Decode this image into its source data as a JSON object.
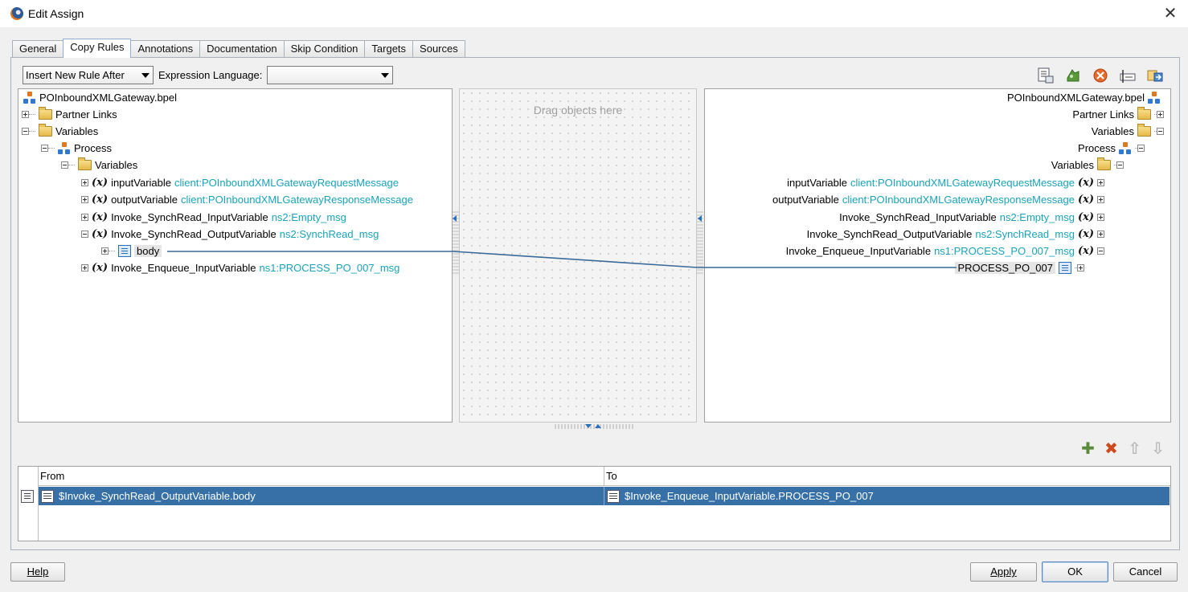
{
  "window": {
    "title": "Edit Assign"
  },
  "tabs": [
    {
      "label": "General"
    },
    {
      "label": "Copy Rules",
      "active": true
    },
    {
      "label": "Annotations"
    },
    {
      "label": "Documentation"
    },
    {
      "label": "Skip Condition"
    },
    {
      "label": "Targets"
    },
    {
      "label": "Sources"
    }
  ],
  "toolbar": {
    "insert_mode": "Insert New Rule After",
    "expression_language_label": "Expression Language:",
    "expression_language_value": ""
  },
  "source_tree": {
    "root": "POInboundXMLGateway.bpel",
    "partner_links": "Partner Links",
    "variables": "Variables",
    "process": "Process",
    "process_variables": "Variables",
    "items": [
      {
        "name": "inputVariable",
        "type": "client:POInboundXMLGatewayRequestMessage"
      },
      {
        "name": "outputVariable",
        "type": "client:POInboundXMLGatewayResponseMessage"
      },
      {
        "name": "Invoke_SynchRead_InputVariable",
        "type": "ns2:Empty_msg"
      },
      {
        "name": "Invoke_SynchRead_OutputVariable",
        "type": "ns2:SynchRead_msg"
      },
      {
        "name": "Invoke_Enqueue_InputVariable",
        "type": "ns1:PROCESS_PO_007_msg"
      }
    ],
    "child_node": "body"
  },
  "middle": {
    "hint": "Drag objects here"
  },
  "target_tree": {
    "root": "POInboundXMLGateway.bpel",
    "partner_links": "Partner Links",
    "variables": "Variables",
    "process": "Process",
    "process_variables": "Variables",
    "items": [
      {
        "name": "inputVariable",
        "type": "client:POInboundXMLGatewayRequestMessage"
      },
      {
        "name": "outputVariable",
        "type": "client:POInboundXMLGatewayResponseMessage"
      },
      {
        "name": "Invoke_SynchRead_InputVariable",
        "type": "ns2:Empty_msg"
      },
      {
        "name": "Invoke_SynchRead_OutputVariable",
        "type": "ns2:SynchRead_msg"
      },
      {
        "name": "Invoke_Enqueue_InputVariable",
        "type": "ns1:PROCESS_PO_007_msg"
      }
    ],
    "child_node": "PROCESS_PO_007"
  },
  "var_glyph": "(x)",
  "rules": {
    "columns": [
      "From",
      "To"
    ],
    "rows": [
      {
        "from": "$Invoke_SynchRead_OutputVariable.body",
        "to": "$Invoke_Enqueue_InputVariable.PROCESS_PO_007"
      }
    ]
  },
  "buttons": {
    "help": "Help",
    "apply": "Apply",
    "ok": "OK",
    "cancel": "Cancel"
  },
  "colors": {
    "type_text": "#1aa3b8",
    "selection": "#3670a7",
    "mapping_line": "#3a6a9a"
  }
}
